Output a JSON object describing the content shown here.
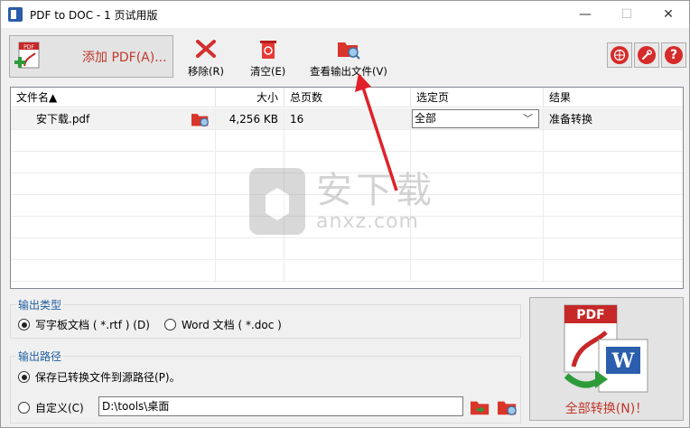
{
  "window": {
    "title": "PDF to DOC - 1 页试用版",
    "minimize": "—",
    "maximize": "☐",
    "close": "✕"
  },
  "toolbar": {
    "add_pdf_label": "添加 PDF(A)...",
    "remove_label": "移除(R)",
    "clear_label": "清空(E)",
    "view_output_label": "查看输出文件(V)"
  },
  "table": {
    "headers": {
      "filename": "文件名▲",
      "size": "大小",
      "pages": "总页数",
      "selected_pages": "选定页",
      "result": "结果"
    },
    "rows": [
      {
        "filename": "安下载.pdf",
        "size": "4,256 KB",
        "pages": "16",
        "selected_pages": "全部",
        "result": "准备转换"
      }
    ]
  },
  "watermark": {
    "cn": "安下载",
    "en": "anxz.com"
  },
  "output_type": {
    "title": "输出类型",
    "option_rtf": "写字板文档 ( *.rtf ) (D)",
    "option_doc": "Word 文档 ( *.doc )",
    "selected": "rtf"
  },
  "output_path": {
    "title": "输出路径",
    "option_source": "保存已转换文件到源路径(P)。",
    "option_custom": "自定义(C)",
    "custom_path": "D:\\tools\\桌面",
    "selected": "source"
  },
  "convert": {
    "label": "全部转换(N)！"
  },
  "colors": {
    "accent_red": "#c0392b",
    "group_title_blue": "#1f5fa0",
    "arrow_red": "#e0202a"
  }
}
